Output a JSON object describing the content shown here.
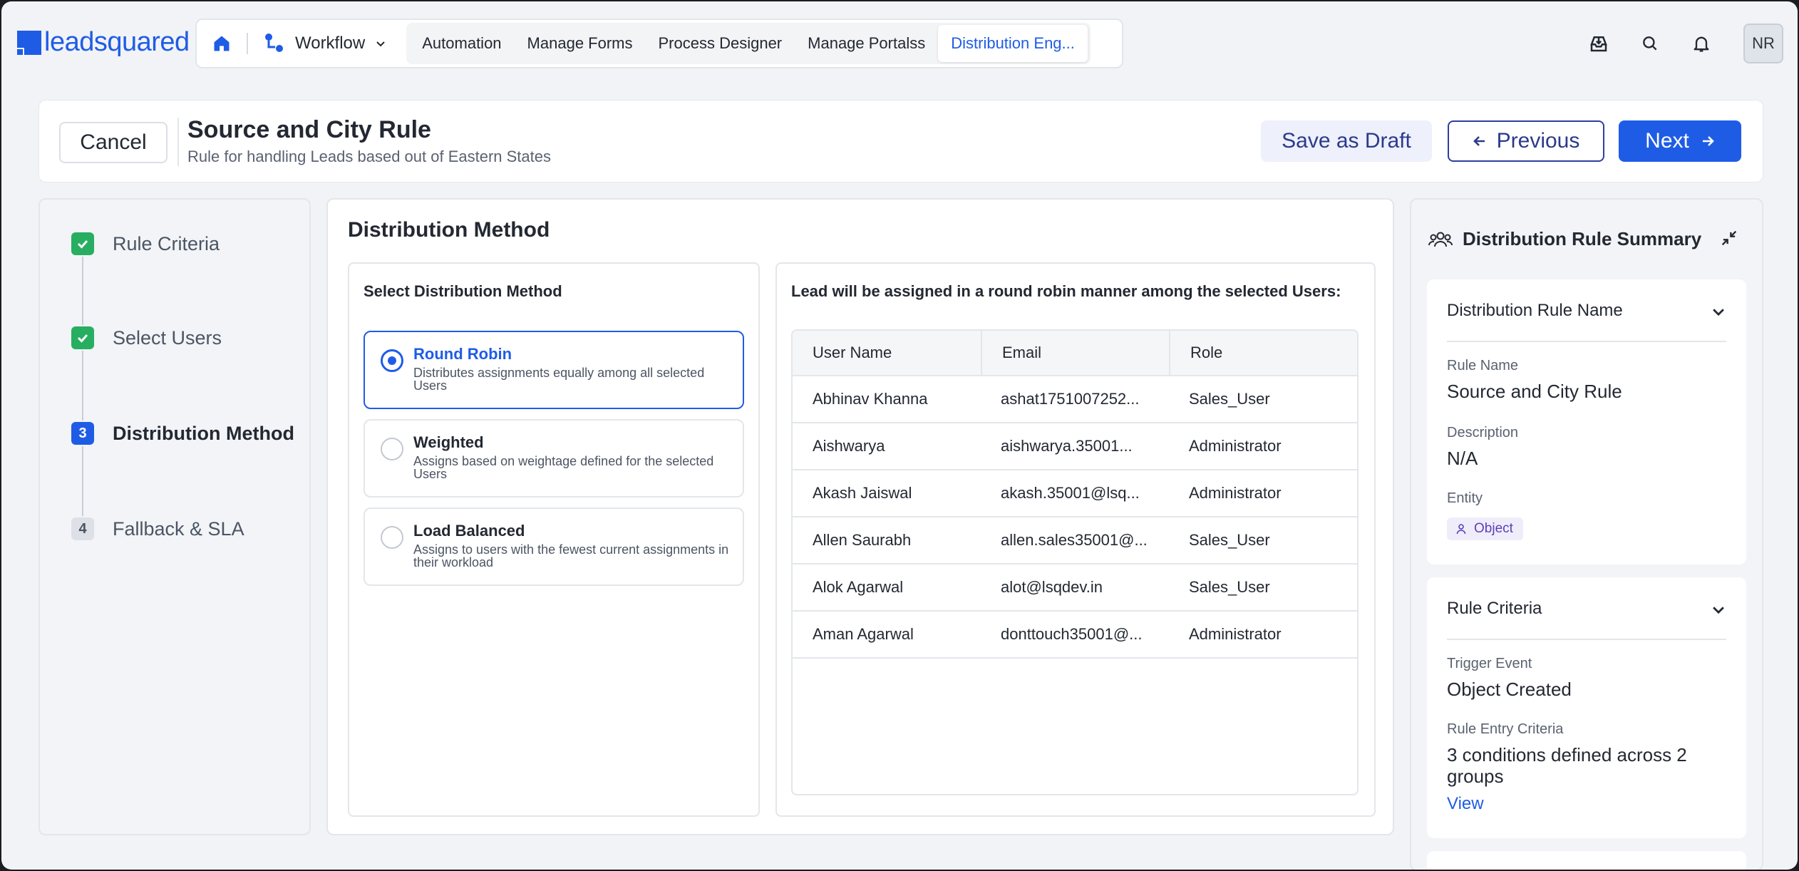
{
  "brand": {
    "logo_text": "leadsquared",
    "accent": "#1f5ce6"
  },
  "nav": {
    "home_icon": "home-icon",
    "workflow_label": "Workflow",
    "tabs": [
      {
        "label": "Automation"
      },
      {
        "label": "Manage Forms"
      },
      {
        "label": "Process Designer"
      },
      {
        "label": "Manage Portalss"
      },
      {
        "label": "Distribution Eng...",
        "active": true
      }
    ]
  },
  "topbar": {
    "icons": [
      "inbox-download-icon",
      "search-icon",
      "bell-icon"
    ],
    "avatar_initials": "NR"
  },
  "header": {
    "cancel_label": "Cancel",
    "title": "Source and City Rule",
    "subtitle": "Rule for handling Leads based out of Eastern States",
    "save_draft_label": "Save as Draft",
    "previous_label": "Previous",
    "next_label": "Next"
  },
  "steps": [
    {
      "number": "",
      "label": "Rule Criteria",
      "status": "done"
    },
    {
      "number": "",
      "label": "Select Users",
      "status": "done"
    },
    {
      "number": "3",
      "label": "Distribution Method",
      "status": "current"
    },
    {
      "number": "4",
      "label": "Fallback & SLA",
      "status": "todo"
    }
  ],
  "main": {
    "title": "Distribution Method",
    "method_heading": "Select Distribution Method",
    "options": [
      {
        "title": "Round Robin",
        "desc": "Distributes assignments equally among all selected Users",
        "selected": true
      },
      {
        "title": "Weighted",
        "desc": "Assigns based on weightage defined for the selected Users",
        "selected": false
      },
      {
        "title": "Load Balanced",
        "desc": "Assigns to users with the fewest current assignments in their workload",
        "selected": false
      }
    ],
    "users_heading": "Lead will be assigned in a round robin manner among the selected Users:",
    "table": {
      "columns": [
        "User Name",
        "Email",
        "Role"
      ],
      "rows": [
        [
          "Abhinav Khanna",
          "ashat1751007252...",
          "Sales_User"
        ],
        [
          "Aishwarya",
          "aishwarya.35001...",
          "Administrator"
        ],
        [
          "Akash Jaiswal",
          "akash.35001@lsq...",
          "Administrator"
        ],
        [
          "Allen Saurabh",
          "allen.sales35001@...",
          "Sales_User"
        ],
        [
          "Alok Agarwal",
          "alot@lsqdev.in",
          "Sales_User"
        ],
        [
          "Aman Agarwal",
          "donttouch35001@...",
          "Administrator"
        ]
      ]
    }
  },
  "summary": {
    "title": "Distribution Rule Summary",
    "name_card": {
      "heading": "Distribution Rule Name",
      "rule_name_label": "Rule Name",
      "rule_name_value": "Source and City Rule",
      "description_label": "Description",
      "description_value": "N/A",
      "entity_label": "Entity",
      "entity_value": "Object"
    },
    "criteria_card": {
      "heading": "Rule Criteria",
      "trigger_label": "Trigger Event",
      "trigger_value": "Object Created",
      "entry_label": "Rule Entry Criteria",
      "entry_value": "3 conditions defined across 2 groups",
      "view_link": "View"
    }
  }
}
